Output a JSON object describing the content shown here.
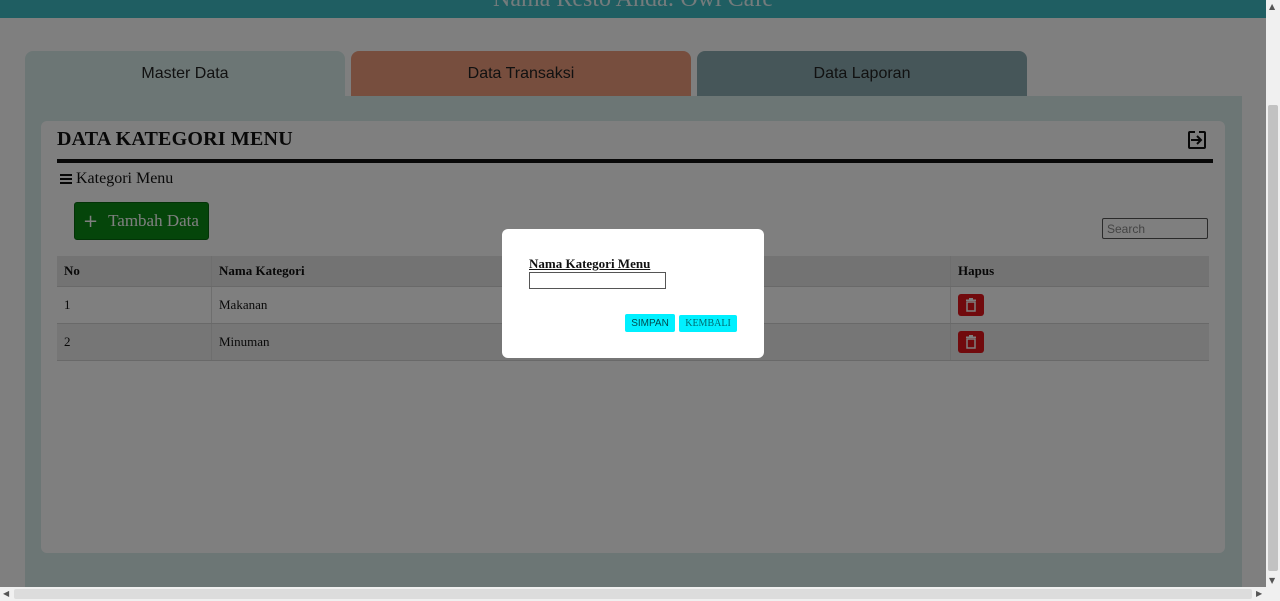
{
  "header": {
    "brand": "Nama Resto Anda: Owl Cafe"
  },
  "tabs": [
    {
      "label": "Master Data"
    },
    {
      "label": "Data Transaksi"
    },
    {
      "label": "Data Laporan"
    }
  ],
  "card": {
    "title": "DATA KATEGORI MENU",
    "subtitle": "Kategori Menu",
    "add_button": "Tambah Data",
    "search_placeholder": "Search"
  },
  "table": {
    "columns": [
      "No",
      "Nama Kategori",
      "Hapus"
    ],
    "rows": [
      {
        "no": "1",
        "nama": "Makanan"
      },
      {
        "no": "2",
        "nama": "Minuman"
      }
    ]
  },
  "modal": {
    "label": "Nama Kategori Menu",
    "input_value": "",
    "save_label": "SIMPAN",
    "back_label": "KEMBALI"
  },
  "colors": {
    "header": "#3fbcc4",
    "tab_master": "#d9ecea",
    "tab_transaksi": "#ee9c7d",
    "tab_laporan": "#8cadb2",
    "add_button": "#0a8a14",
    "delete_button": "#e3141b",
    "modal_buttons": "#00f0ff"
  },
  "icons": {
    "logout": "logout-icon",
    "menu": "hamburger-icon",
    "add": "plus-icon",
    "delete": "trash-icon"
  }
}
